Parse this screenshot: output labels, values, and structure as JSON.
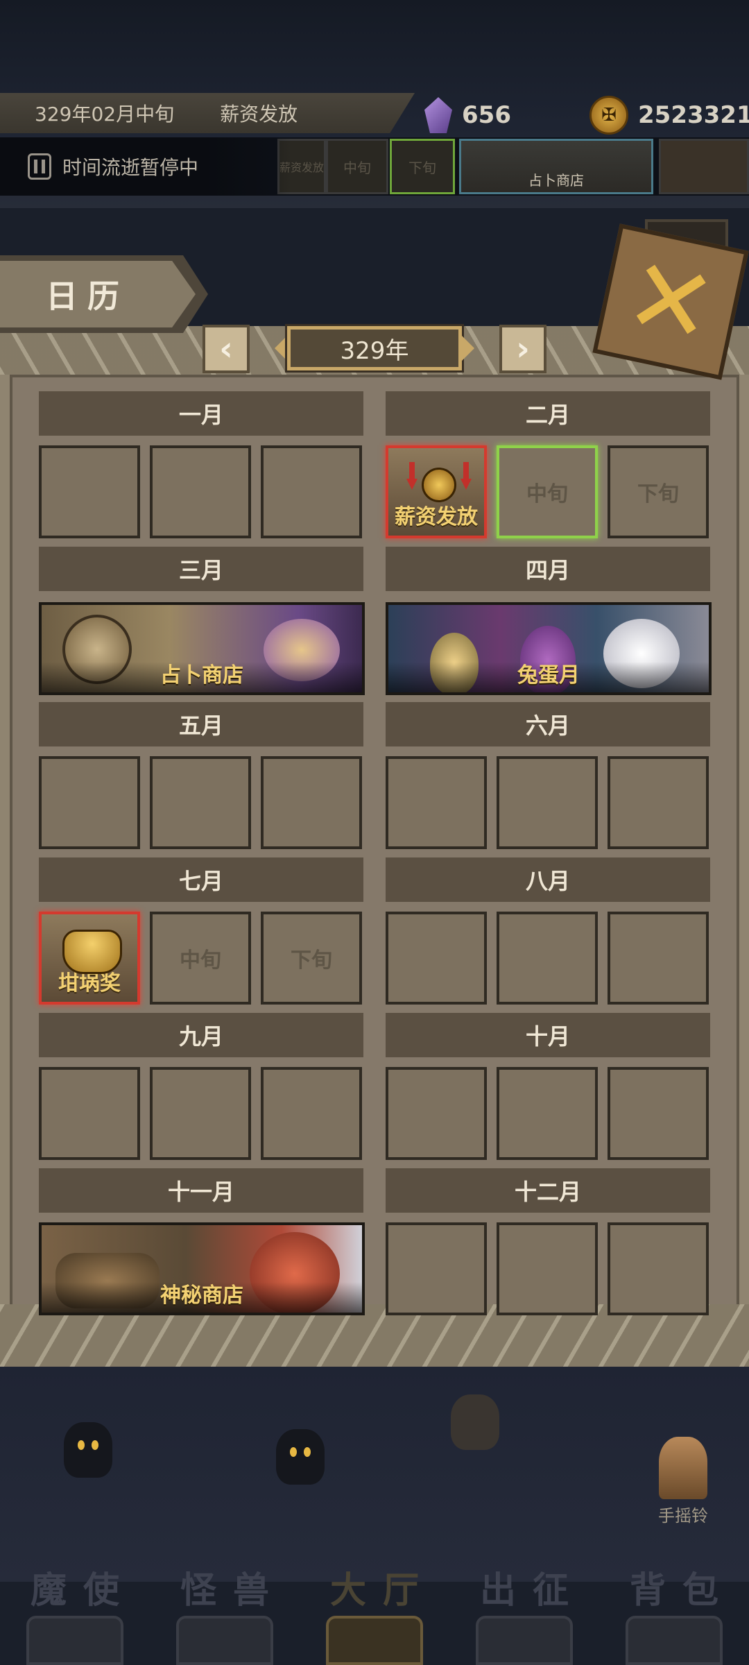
{
  "hud": {
    "date": "329年02月中旬",
    "event": "薪资发放",
    "gems": "656",
    "gold": "2523321",
    "pause_text": "时间流逝暂停中",
    "timeline": [
      "薪资发放",
      "中旬",
      "下旬",
      "占卜商店"
    ]
  },
  "panel": {
    "title": "日历",
    "year": "329年",
    "prev": "‹",
    "next": "›",
    "close": "✕"
  },
  "months": {
    "m1": "一月",
    "m2": "二月",
    "m3": "三月",
    "m4": "四月",
    "m5": "五月",
    "m6": "六月",
    "m7": "七月",
    "m8": "八月",
    "m9": "九月",
    "m10": "十月",
    "m11": "十一月",
    "m12": "十二月"
  },
  "cells": {
    "feb_early": "薪资发放",
    "feb_mid": "中旬",
    "feb_late": "下旬",
    "jul_early": "坩埚奖",
    "jul_mid": "中旬",
    "jul_late": "下旬"
  },
  "banners": {
    "mar": "占卜商店",
    "apr": "兔蛋月",
    "nov": "神秘商店"
  },
  "scene": {
    "bell_label": "手摇铃"
  },
  "nav": {
    "items": [
      "魔使",
      "怪兽",
      "大厅",
      "出征",
      "背包"
    ]
  },
  "colors": {
    "current_border": "#8fd24a",
    "event_border": "#d43a2e",
    "label_gold": "#f3d172"
  }
}
